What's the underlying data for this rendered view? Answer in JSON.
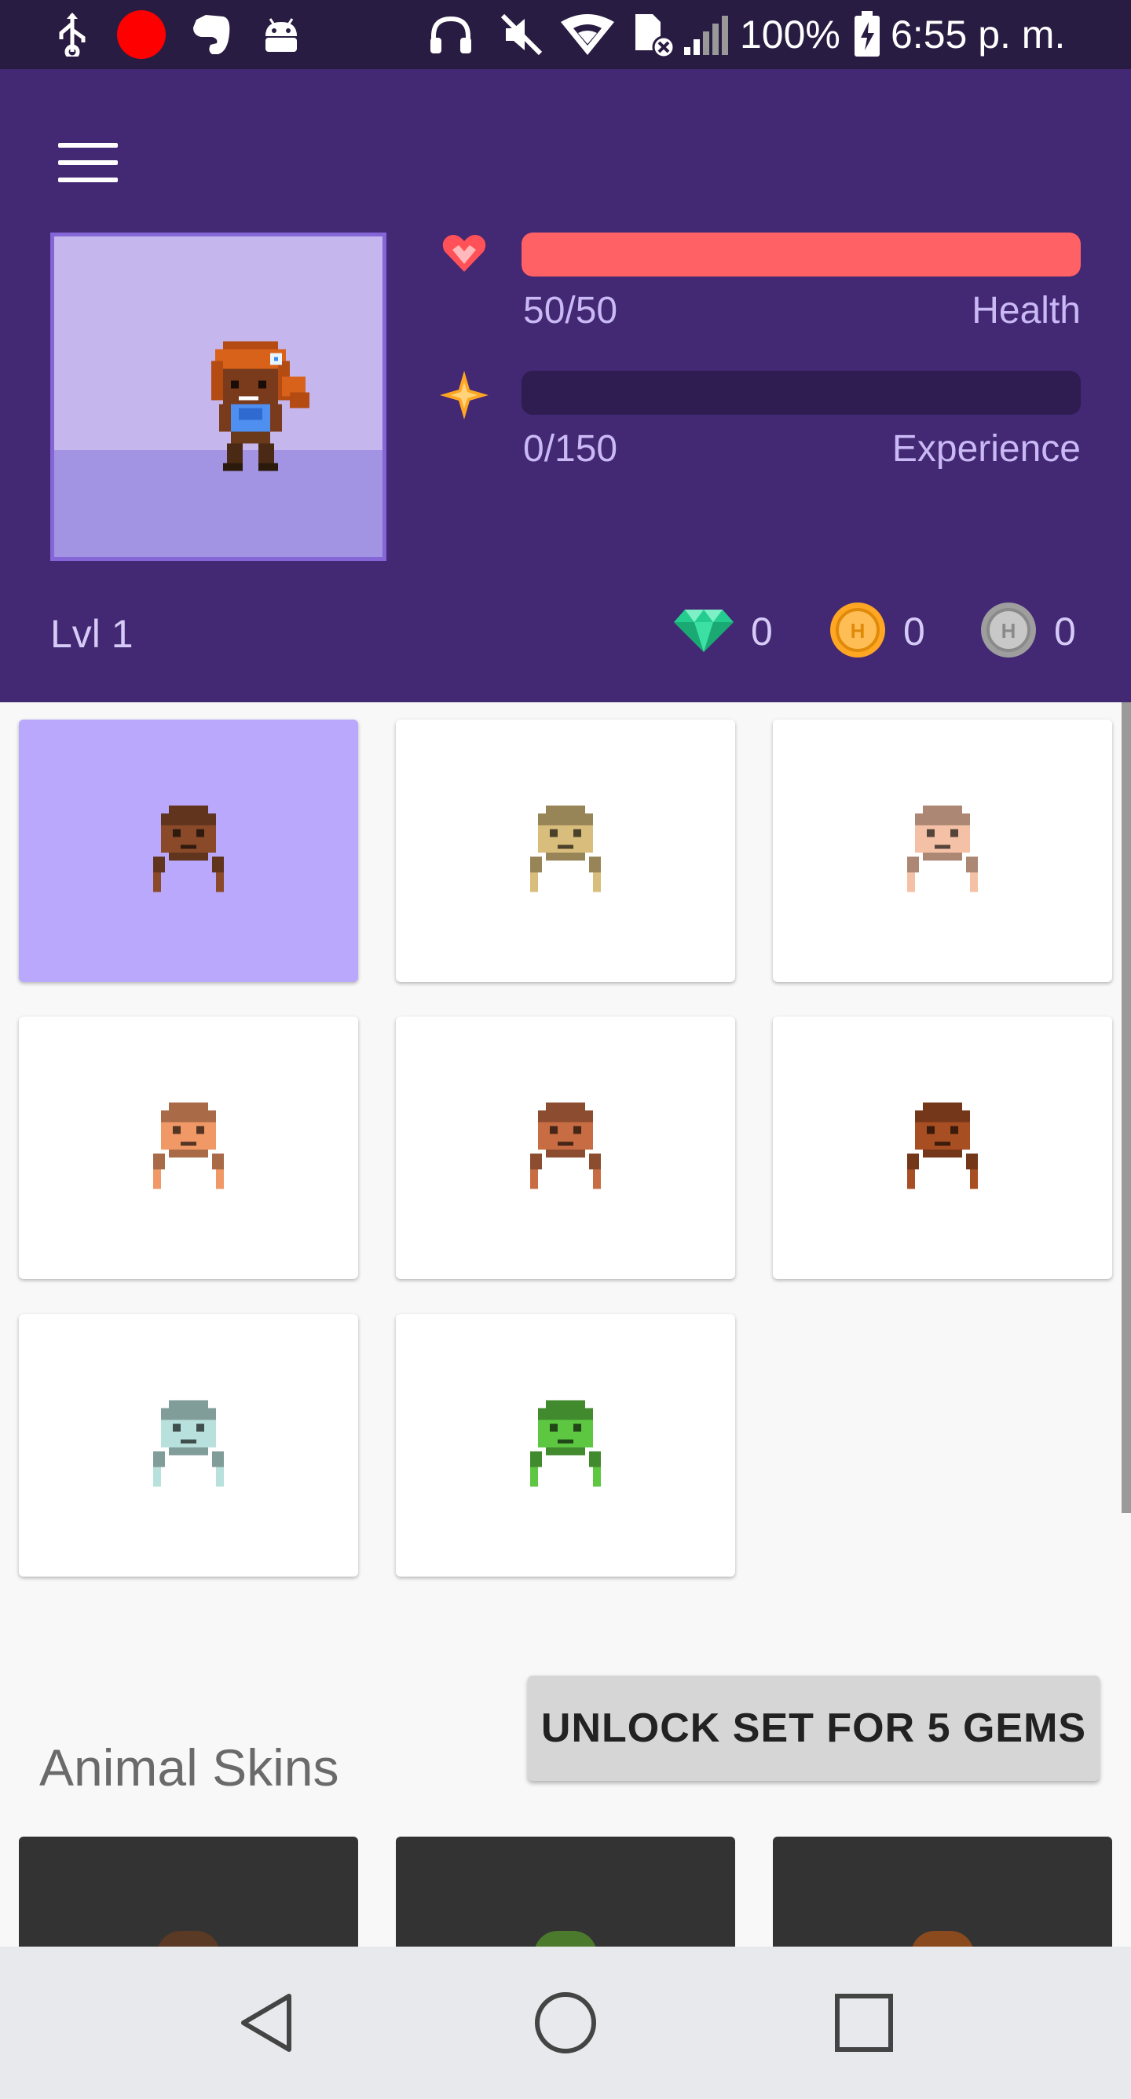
{
  "status_bar": {
    "battery_text": "100%",
    "time_text": "6:55 p. m.",
    "icons": [
      "usb-icon",
      "record-icon",
      "evernote-icon",
      "android-debug-icon",
      "headphones-icon",
      "mute-icon",
      "wifi-icon",
      "no-sim-icon",
      "signal-icon",
      "battery-charging-icon"
    ]
  },
  "header": {
    "menu_icon": "hamburger-menu-icon",
    "health": {
      "text": "50/50",
      "label": "Health",
      "current": 50,
      "max": 50,
      "color": "#ff6165",
      "icon": "heart-icon"
    },
    "experience": {
      "text": "0/150",
      "label": "Experience",
      "current": 0,
      "max": 150,
      "color": "#ffa623",
      "icon": "star-icon"
    },
    "level_text": "Lvl 1",
    "gems": "0",
    "gold": "0",
    "hourglasses": "0"
  },
  "colors": {
    "header_bg": "#432874",
    "selected_card_bg": "#b9a8fb",
    "health_fill": "#ff6165",
    "bar_track": "#2f1d52"
  },
  "skins": [
    {
      "name": "skin-dark-brown",
      "color": "#8a4a2a",
      "selected": true
    },
    {
      "name": "skin-tan",
      "color": "#d8bd7c",
      "selected": false
    },
    {
      "name": "skin-pale-peach",
      "color": "#f4c1a6",
      "selected": false
    },
    {
      "name": "skin-peach",
      "color": "#f09866",
      "selected": false
    },
    {
      "name": "skin-medium-brown",
      "color": "#c86d43",
      "selected": false
    },
    {
      "name": "skin-deep-brown",
      "color": "#a74e23",
      "selected": false
    },
    {
      "name": "skin-pale-cyan",
      "color": "#b8e0dc",
      "selected": false
    },
    {
      "name": "skin-green",
      "color": "#5dc741",
      "selected": false
    }
  ],
  "unlock_button": "UNLOCK SET FOR 5 GEMS",
  "animal_section_title": "Animal Skins",
  "animal_skins_peek_colors": [
    "#5a3a24",
    "#4c7a2c",
    "#8a4a1e"
  ],
  "nav": {
    "back_icon": "back-triangle-icon",
    "home_icon": "home-circle-icon",
    "recents_icon": "recents-square-icon"
  }
}
